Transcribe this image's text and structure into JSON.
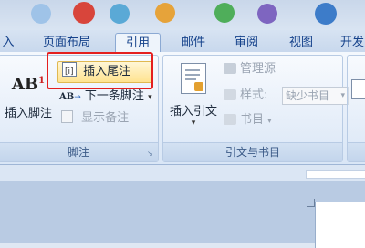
{
  "tabs": [
    "入",
    "页面布局",
    "引用",
    "邮件",
    "审阅",
    "视图",
    "开发"
  ],
  "active_tab": "引用",
  "footnotes_group": {
    "label": "脚注",
    "insert_footnote_icon_text": "AB",
    "insert_footnote_sup": "1",
    "insert_footnote": "插入脚注",
    "insert_endnote": "插入尾注",
    "next_footnote_icon_text": "AB",
    "next_footnote": "下一条脚注",
    "show_notes": "显示备注"
  },
  "citations_group": {
    "label": "引文与书目",
    "insert_citation": "插入引文",
    "manage_sources": "管理源",
    "style_label": "样式:",
    "style_value": "缺少书目",
    "bibliography": "书目"
  },
  "colors": {
    "highlight": "#e41f1f",
    "tab_text": "#15428b"
  }
}
